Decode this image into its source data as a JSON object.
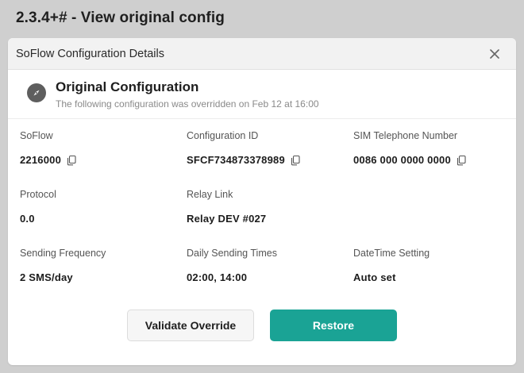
{
  "page": {
    "title": "2.3.4+# - View original config"
  },
  "modal": {
    "title": "SoFlow Configuration Details",
    "close_icon": "close-icon",
    "section": {
      "icon": "compass-icon",
      "title": "Original Configuration",
      "subtitle": "The following configuration was overridden on Feb 12 at 16:00"
    },
    "fields": {
      "soflow": {
        "label": "SoFlow",
        "value": "2216000"
      },
      "config_id": {
        "label": "Configuration ID",
        "value": "SFCF734873378989"
      },
      "sim_phone": {
        "label": "SIM Telephone Number",
        "value": "0086 000 0000 0000"
      },
      "protocol": {
        "label": "Protocol",
        "value": "0.0"
      },
      "relay_link": {
        "label": "Relay Link",
        "value": "Relay DEV #027"
      },
      "sending_frequency": {
        "label": "Sending Frequency",
        "value": "2 SMS/day"
      },
      "daily_sending_times": {
        "label": "Daily Sending Times",
        "value": "02:00, 14:00"
      },
      "datetime_setting": {
        "label": "DateTime Setting",
        "value": "Auto set"
      }
    },
    "actions": {
      "validate_label": "Validate Override",
      "restore_label": "Restore"
    },
    "colors": {
      "primary": "#1aa395",
      "backdrop": "#cfcfcf"
    }
  }
}
